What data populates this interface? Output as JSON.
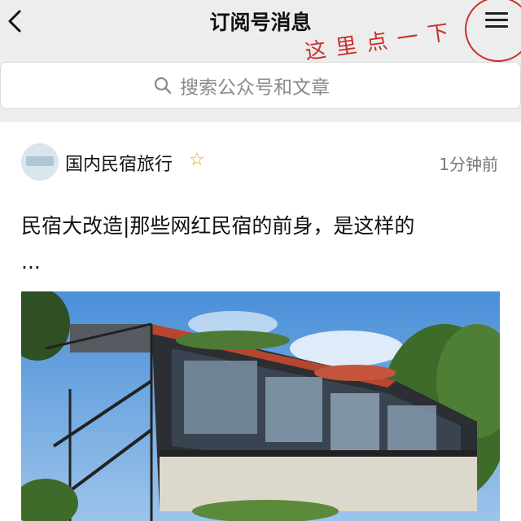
{
  "header": {
    "title": "订阅号消息"
  },
  "annotation": {
    "hint_text": "这里点一下"
  },
  "search": {
    "placeholder": "搜索公众号和文章"
  },
  "article": {
    "account_name": "国内民宿旅行",
    "time": "1分钟前",
    "title": "民宿大改造|那些网红民宿的前身，是这样的",
    "ellipsis": "..."
  },
  "colors": {
    "annotation_red": "#c9302c",
    "star_yellow": "#e0a800"
  }
}
